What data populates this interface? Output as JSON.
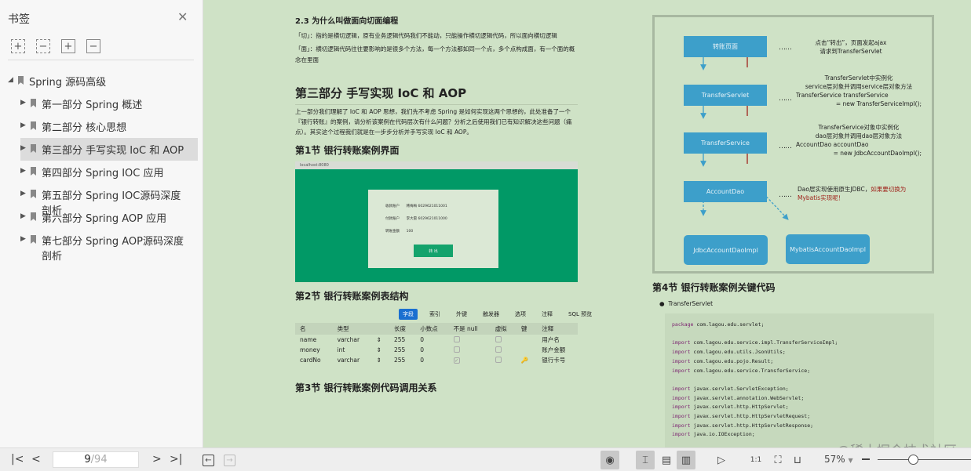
{
  "sidebar": {
    "title": "书签",
    "items": [
      {
        "label": "Spring 源码高级"
      },
      {
        "label": "第一部分 Spring 概述"
      },
      {
        "label": "第二部分 核心思想"
      },
      {
        "label": "第三部分 手写实现 IoC 和 AOP"
      },
      {
        "label": "第四部分 Spring IOC 应用"
      },
      {
        "label": "第五部分 Spring IOC源码深度剖析"
      },
      {
        "label": "第六部分 Spring AOP 应用"
      },
      {
        "label": "第七部分 Spring AOP源码深度剖析"
      }
    ],
    "selected_index": 3
  },
  "doc": {
    "s23_title": "2.3 为什么叫做面向切面编程",
    "s23_p1": "「切」：指的是横切逻辑，原有业务逻辑代码我们不能动，只能操作横切逻辑代码，所以面向横切逻辑",
    "s23_p2": "「面」：横切逻辑代码往往要影响的是很多个方法，每一个方法都如同一个点，多个点构成面，有一个面的概念在里面",
    "part3_title": "第三部分 手写实现 IoC 和 AOP",
    "part3_intro": "上一部分我们理解了 IoC 和 AOP 思想，我们先不考虑 Spring 是如何实现这两个思想的，此处准备了一个『银行转账』的案例，请分析该案例在代码层次有什么问题？分析之后使用我们已有知识解决这些问题（痛点）。其实这个过程我们就是在一步步分析并手写实现 IoC 和 AOP。",
    "sec1_title": "第1节 银行转账案例界面",
    "browser": {
      "url": "localhost:8080",
      "fields": [
        {
          "label": "收款账户",
          "value": "韩梅梅 6029621011001"
        },
        {
          "label": "付款账户",
          "value": "李大雷 6029621011000"
        },
        {
          "label": "转账金额",
          "value": "100"
        }
      ],
      "button": "转 出"
    },
    "sec2_title": "第2节 银行转账案例表结构",
    "table_tabs": [
      "字段",
      "索引",
      "外键",
      "触发器",
      "选项",
      "注释",
      "SQL 预览"
    ],
    "table_headers": [
      "名",
      "类型",
      "",
      "长度",
      "小数点",
      "不是 null",
      "虚拟",
      "键",
      "注释"
    ],
    "table_rows": [
      {
        "name": "name",
        "type": "varchar",
        "length": "255",
        "decimal": "0",
        "notnull": false,
        "key": false,
        "comment": "用户名"
      },
      {
        "name": "money",
        "type": "int",
        "length": "255",
        "decimal": "0",
        "notnull": false,
        "key": false,
        "comment": "账户金额"
      },
      {
        "name": "cardNo",
        "type": "varchar",
        "length": "255",
        "decimal": "0",
        "notnull": true,
        "key": true,
        "comment": "银行卡号"
      }
    ],
    "sec3_title": "第3节 银行转账案例代码调用关系",
    "diagram": {
      "nodes": [
        "转账页面",
        "TransferServlet",
        "TransferService",
        "AccountDao",
        "JdbcAccountDaoImpl",
        "MybatisAccountDaoImpl"
      ],
      "notes": [
        [
          "点击“转出”，页面发起ajax",
          "请求到TransferServlet"
        ],
        [
          "TransferServlet中实例化",
          "service层对象并调用service层对象方法",
          "TransferService transferService",
          "= new TransferServiceImpl();"
        ],
        [
          "TransferService对象中实例化",
          "dao层对象并调用dao层对象方法",
          "AccountDao accountDao",
          "= new JdbcAccountDaoImpl();"
        ]
      ],
      "note4_a": "Dao层实现使用原生JDBC，",
      "note4_b": "如果要切换为",
      "note4_c": "Mybatis实现呢！",
      "dots": "……"
    },
    "sec4_title": "第4节 银行转账案例关键代码",
    "bullet": "TransferServlet",
    "code": [
      [
        "package",
        "com.lagou.edu.servlet;"
      ],
      [],
      [
        "import",
        "com.lagou.edu.service.impl.TransferServiceImpl;"
      ],
      [
        "import",
        "com.lagou.edu.utils.JsonUtils;"
      ],
      [
        "import",
        "com.lagou.edu.pojo.Result;"
      ],
      [
        "import",
        "com.lagou.edu.service.TransferService;"
      ],
      [],
      [
        "import",
        "javax.servlet.ServletException;"
      ],
      [
        "import",
        "javax.servlet.annotation.WebServlet;"
      ],
      [
        "import",
        "javax.servlet.http.HttpServlet;"
      ],
      [
        "import",
        "javax.servlet.http.HttpServletRequest;"
      ],
      [
        "import",
        "javax.servlet.http.HttpServletResponse;"
      ],
      [
        "import",
        "java.io.IOException;"
      ]
    ]
  },
  "bottombar": {
    "current_page": "9",
    "total_pages": "/94",
    "zoom": "57%",
    "zoom_fraction": 0.57
  },
  "watermark": "@稀土掘金技术社区"
}
